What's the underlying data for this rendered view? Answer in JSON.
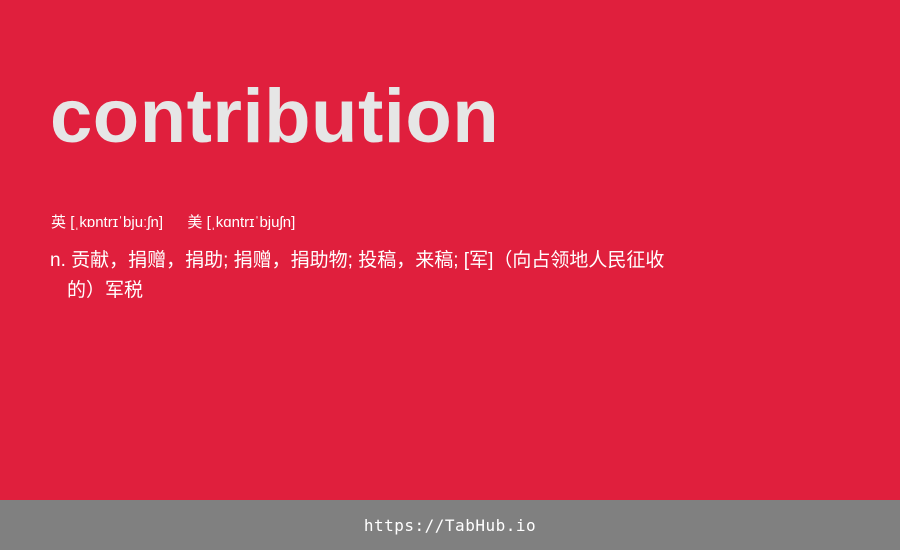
{
  "entry": {
    "word": "contribution",
    "uk_label": "英",
    "uk_ipa": "[ˌkɒntrɪˈbjuːʃn]",
    "us_label": "美",
    "us_ipa": "[ˌkɑntrɪˈbjuʃn]",
    "definition_line1": "n. 贡献，捐赠，捐助; 捐赠，捐助物; 投稿，来稿; [军]（向占领地人民征收",
    "definition_line2": "的）军税"
  },
  "footer": {
    "url": "https://TabHub.io"
  },
  "colors": {
    "background": "#e01f3d",
    "word": "#e6e6e6",
    "footer": "#808080"
  }
}
